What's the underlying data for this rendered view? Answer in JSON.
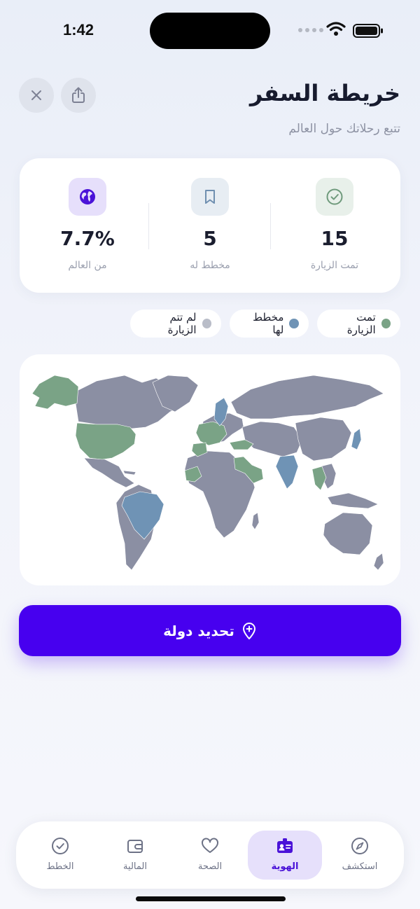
{
  "status": {
    "time": "1:42"
  },
  "header": {
    "title": "خريطة السفر",
    "subtitle": "تتبع رحلاتك حول العالم"
  },
  "stats": [
    {
      "value": "15",
      "label": "تمت الزيارة",
      "icon": "check-circle-icon"
    },
    {
      "value": "5",
      "label": "مخطط له",
      "icon": "bookmark-icon"
    },
    {
      "value": "7.7%",
      "label": "من العالم",
      "icon": "globe-icon"
    }
  ],
  "legend": [
    {
      "label": "تمت الزيارة",
      "color": "#7aa386"
    },
    {
      "label": "مخطط لها",
      "color": "#6f93b5"
    },
    {
      "label": "لم تتم الزيارة",
      "color": "#b9bdc8"
    }
  ],
  "map": {
    "unvisited_color": "#8b8fa3",
    "visited_color": "#7aa386",
    "planned_color": "#6f93b5"
  },
  "action": {
    "label": "تحديد دولة"
  },
  "tabs": [
    {
      "label": "الخطط",
      "icon": "check-circle-icon",
      "active": false
    },
    {
      "label": "المالية",
      "icon": "wallet-icon",
      "active": false
    },
    {
      "label": "الصحة",
      "icon": "heart-icon",
      "active": false
    },
    {
      "label": "الهوية",
      "icon": "id-badge-icon",
      "active": true
    },
    {
      "label": "استكشف",
      "icon": "compass-icon",
      "active": false
    }
  ],
  "colors": {
    "accent": "#4700ef",
    "active_tab_bg": "#e6e0fb"
  }
}
